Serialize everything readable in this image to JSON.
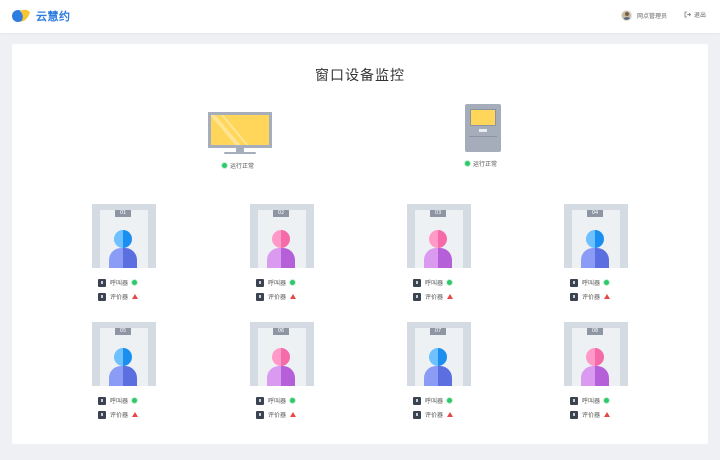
{
  "app": {
    "name": "云慧约"
  },
  "header": {
    "user_name": "网点管理员",
    "logout_label": "退出"
  },
  "page": {
    "title": "窗口设备监控"
  },
  "devices": {
    "monitor": {
      "status": "运行正常"
    },
    "kiosk": {
      "status": "运行正常"
    }
  },
  "windows": [
    {
      "number": "01",
      "style": "blue",
      "caller_label": "呼叫器",
      "caller_status": "ok",
      "evaluator_label": "评价器",
      "evaluator_status": "warning"
    },
    {
      "number": "02",
      "style": "pink",
      "caller_label": "呼叫器",
      "caller_status": "ok",
      "evaluator_label": "评价器",
      "evaluator_status": "warning"
    },
    {
      "number": "03",
      "style": "pink",
      "caller_label": "呼叫器",
      "caller_status": "ok",
      "evaluator_label": "评价器",
      "evaluator_status": "warning"
    },
    {
      "number": "04",
      "style": "blue",
      "caller_label": "呼叫器",
      "caller_status": "ok",
      "evaluator_label": "评价器",
      "evaluator_status": "warning"
    },
    {
      "number": "05",
      "style": "blue",
      "caller_label": "呼叫器",
      "caller_status": "ok",
      "evaluator_label": "评价器",
      "evaluator_status": "warning"
    },
    {
      "number": "06",
      "style": "pink",
      "caller_label": "呼叫器",
      "caller_status": "ok",
      "evaluator_label": "评价器",
      "evaluator_status": "warning"
    },
    {
      "number": "07",
      "style": "blue",
      "caller_label": "呼叫器",
      "caller_status": "ok",
      "evaluator_label": "评价器",
      "evaluator_status": "warning"
    },
    {
      "number": "08",
      "style": "pink",
      "caller_label": "呼叫器",
      "caller_status": "ok",
      "evaluator_label": "评价器",
      "evaluator_status": "warning"
    }
  ],
  "colors": {
    "brand": "#2f7ce0",
    "ok": "#2ec86a",
    "warning": "#e64848",
    "blue_head": [
      "#6ec0ff",
      "#1a8ff0"
    ],
    "blue_body": [
      "#8a9cf5",
      "#5b6fe0"
    ],
    "pink_head": [
      "#ff9ac8",
      "#f56aa8"
    ],
    "pink_body": [
      "#d99af0",
      "#b55fd8"
    ]
  }
}
